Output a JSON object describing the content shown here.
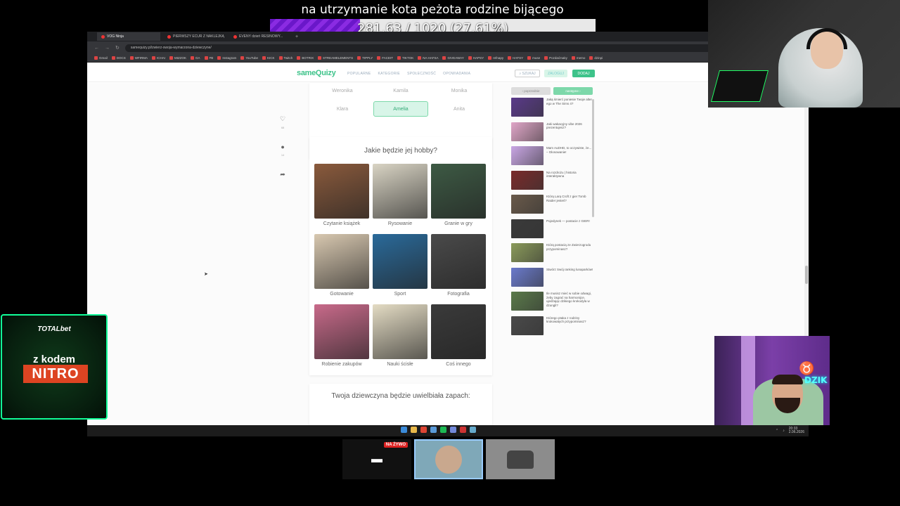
{
  "overlay": {
    "donation_title": "na utrzymanie kota peżota rodzine bijącego",
    "donation_progress_text": "281.63 / 1020 (27.61%)",
    "donation_progress_fraction": 0.2761
  },
  "browser": {
    "tabs": [
      "VOG Ninja",
      "PIERWSZY ECUR Z NAKLEJKĄ",
      "EVENY dzień RESINOWY..."
    ],
    "url": "samequizy.pl/zwierz-swoja-wymarzona-dziewczyne/",
    "bookmarks": [
      "Gmail",
      "DOCS",
      "WFIRMA",
      "ICHAI",
      "MIZZOK",
      "GA",
      "FB",
      "Instagram",
      "YouTube",
      "KICK",
      "Twitch",
      "BOTRIX",
      "STREAMELEMENTS",
      "TIPPLY",
      "FACEIT",
      "TIKTOK",
      "NA HAFSA",
      "GIVEAWAY",
      "HAPSY",
      "refnapy",
      "HAFSY",
      "muse",
      "Pozdaćmaky",
      "memo",
      "dzinpi"
    ]
  },
  "site": {
    "logo": "sameQuizy",
    "nav": [
      "POPULARNE",
      "KATEGORIE",
      "SPOŁECZNOŚĆ",
      "OPOWIADANIA"
    ],
    "search_label": "SZUKAJ",
    "login_label": "ZALOGUJ",
    "add_label": "DODAJ",
    "side_actions": [
      {
        "icon": "heart-icon",
        "count": "68"
      },
      {
        "icon": "comment-icon",
        "count": "14"
      },
      {
        "icon": "share-icon",
        "count": ""
      }
    ]
  },
  "quiz": {
    "names": [
      "Weronika",
      "Kamila",
      "Monika",
      "Klara",
      "Amelia",
      "Anita"
    ],
    "selected_name_index": 4,
    "question_hobby": "Jakie będzie jej hobby?",
    "hobbies": [
      {
        "label": "Czytanie książek",
        "color": "#8a5a3c"
      },
      {
        "label": "Rysowanie",
        "color": "#d9d4c4"
      },
      {
        "label": "Granie w gry",
        "color": "#3d5a44"
      },
      {
        "label": "Gotowanie",
        "color": "#d8c8b0"
      },
      {
        "label": "Sport",
        "color": "#2a6a9a"
      },
      {
        "label": "Fotografia",
        "color": "#4a4a4a"
      },
      {
        "label": "Robienie zakupów",
        "color": "#c86a8a"
      },
      {
        "label": "Nauki ścisłe",
        "color": "#e4dcc4"
      },
      {
        "label": "Coś innego",
        "color": "#3a3a3a"
      }
    ],
    "question_scent": "Twoja dziewczyna będzie uwielbiała zapach:"
  },
  "sidebar": {
    "tab_prev": "poprzednie",
    "tab_next": "następne",
    "items": [
      {
        "title": "Jaką śmierć poniesie Twoje alter ego w The Sims 4?",
        "color": "#5a3a8a"
      },
      {
        "title": "Jaki wakacyjny vibe 2026 prezentujesz?",
        "color": "#e0a6c8"
      },
      {
        "title": "Mam AuDHD, to oczywiste, że... – Głosowanie!",
        "color": "#c9a6e4"
      },
      {
        "title": "Na rozdrożu | historia interaktywna",
        "color": "#7a2a2a"
      },
      {
        "title": "Którą Larą Croft z gier Tomb Raider jesteś?",
        "color": "#6a5a4a"
      },
      {
        "title": "Pojedynek — postacie z GIER!",
        "color": "#3a3a3a"
      },
      {
        "title": "Którą postacią ze Zwierzogrodu przypominasz?",
        "color": "#8a9a5a"
      },
      {
        "title": "Stwórz Swój ranking lunaparków!",
        "color": "#6a7acc"
      },
      {
        "title": "Ile musisz mieć w sobie odwagi, żeby zagrać na harmonijce, ujedżając dzikiego krokodyla w dzungli?",
        "color": "#5a7a4a"
      },
      {
        "title": "Którego ptaka z rodziny krukowatych przypominasz?",
        "color": "#4a4a4a"
      }
    ]
  },
  "taskbar": {
    "date": "2.06.2026",
    "time": "20:33"
  },
  "sponsor": {
    "brand": "TOTALbet",
    "code_label": "z kodem",
    "code": "NITRO"
  },
  "scenes": {
    "live_badge": "NA ŻYWO"
  },
  "cam2": {
    "logo": "DZIK"
  }
}
